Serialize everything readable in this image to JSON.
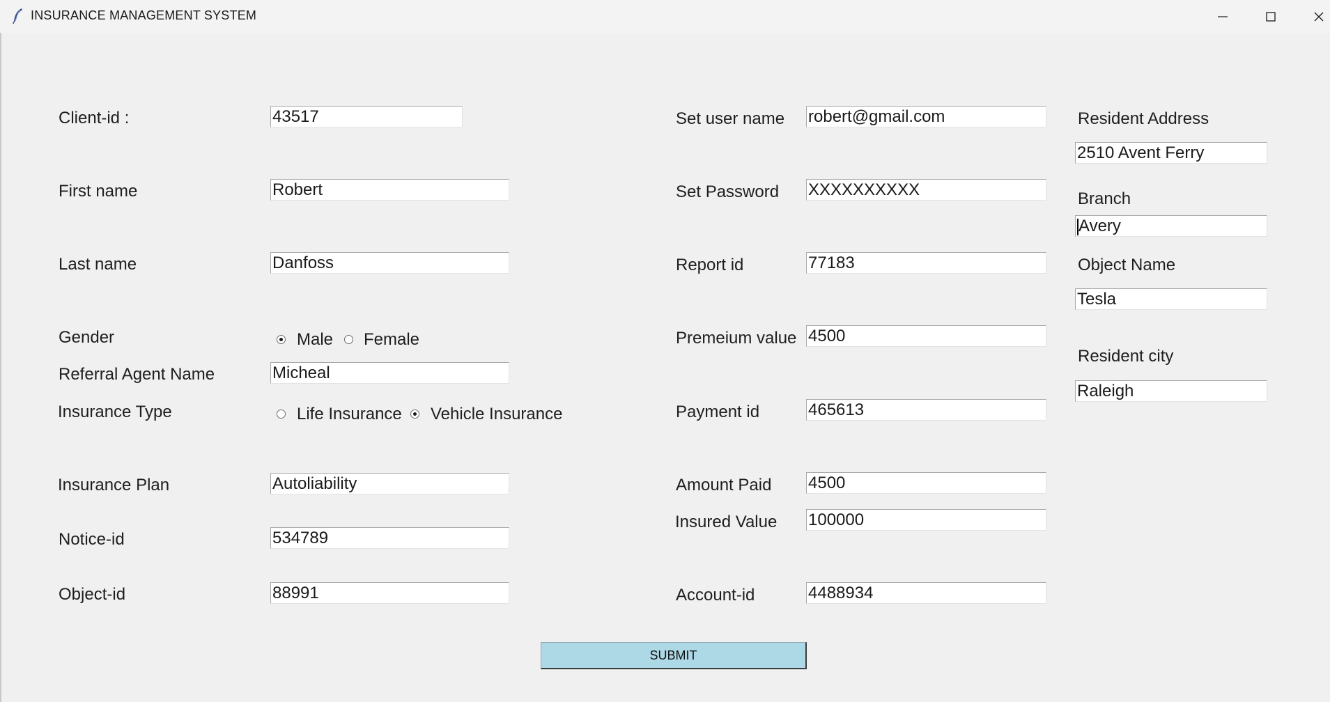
{
  "window": {
    "title": "INSURANCE MANAGEMENT SYSTEM"
  },
  "form": {
    "client_id": {
      "label": "Client-id :",
      "value": "43517"
    },
    "first_name": {
      "label": "First name",
      "value": "Robert"
    },
    "last_name": {
      "label": "Last name",
      "value": "Danfoss"
    },
    "gender": {
      "label": "Gender",
      "options": [
        "Male",
        "Female"
      ],
      "selected": "Male"
    },
    "referral_agent": {
      "label": "Referral Agent Name",
      "value": "Micheal"
    },
    "insurance_type": {
      "label": "Insurance Type",
      "options": [
        "Life Insurance",
        "Vehicle Insurance"
      ],
      "selected": "Vehicle Insurance"
    },
    "insurance_plan": {
      "label": "Insurance Plan",
      "value": "Autoliability"
    },
    "notice_id": {
      "label": "Notice-id",
      "value": "534789"
    },
    "object_id": {
      "label": "Object-id",
      "value": "88991"
    },
    "user_name": {
      "label": "Set user name",
      "value": "robert@gmail.com"
    },
    "password": {
      "label": "Set Password",
      "value": "XXXXXXXXXX"
    },
    "report_id": {
      "label": "Report id",
      "value": "77183"
    },
    "premium_value": {
      "label": "Premeium value",
      "value": "4500"
    },
    "payment_id": {
      "label": "Payment id",
      "value": "465613"
    },
    "amount_paid": {
      "label": "Amount Paid",
      "value": "4500"
    },
    "insured_value": {
      "label": "Insured Value",
      "value": "100000"
    },
    "account_id": {
      "label": "Account-id",
      "value": "4488934"
    },
    "resident_address": {
      "label": "Resident Address",
      "value": "2510 Avent Ferry"
    },
    "branch": {
      "label": "Branch",
      "value": "Avery"
    },
    "object_name": {
      "label": "Object Name",
      "value": "Tesla"
    },
    "resident_city": {
      "label": "Resident city",
      "value": "Raleigh"
    },
    "submit_label": "SUBMIT"
  }
}
